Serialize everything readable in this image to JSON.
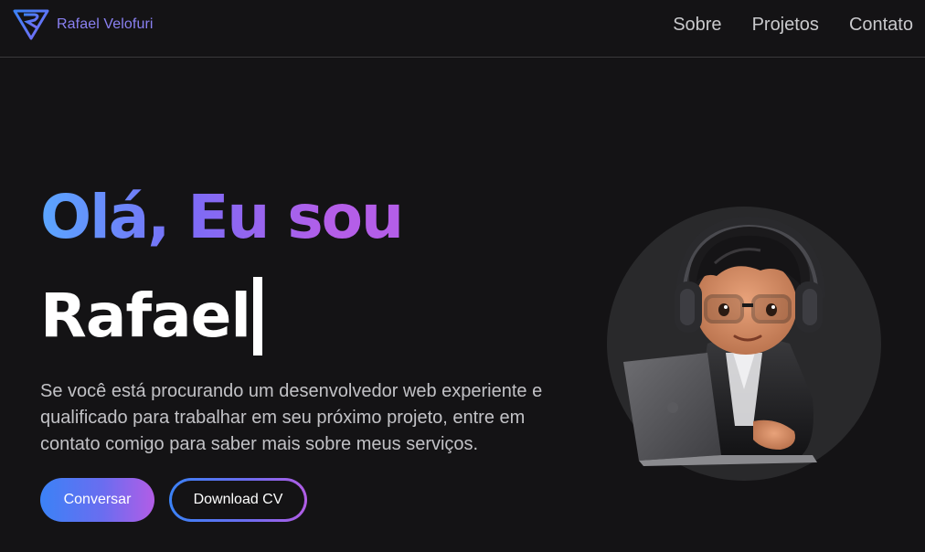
{
  "header": {
    "brand": "Rafael Velofuri",
    "nav": [
      {
        "label": "Sobre"
      },
      {
        "label": "Projetos"
      },
      {
        "label": "Contato"
      }
    ]
  },
  "hero": {
    "greeting": "Olá, Eu sou",
    "name": "Rafael",
    "description": "Se você está procurando um desenvolvedor web experiente e qualificado para trabalhar em seu próximo projeto, entre em contato comigo para saber mais sobre meus serviços.",
    "primary_button": "Conversar",
    "secondary_button": "Download CV"
  },
  "colors": {
    "background": "#141315",
    "brand_text": "#8a80f2",
    "gradient_start": "#3b82f6",
    "gradient_end": "#b25de6",
    "avatar_bg": "#29292b"
  },
  "icons": {
    "logo": "rv-logo-icon",
    "avatar": "developer-avatar-illustration"
  }
}
